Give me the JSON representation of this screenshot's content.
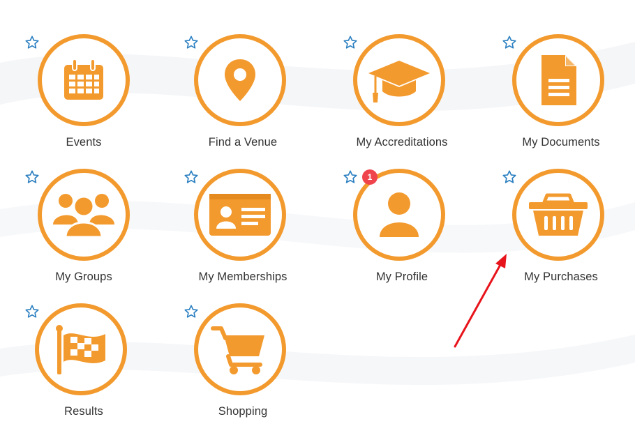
{
  "tiles": [
    {
      "label": "Events",
      "icon": "calendar-icon"
    },
    {
      "label": "Find a Venue",
      "icon": "location-pin-icon"
    },
    {
      "label": "My Accreditations",
      "icon": "graduation-cap-icon"
    },
    {
      "label": "My Documents",
      "icon": "document-icon"
    },
    {
      "label": "My Groups",
      "icon": "group-icon"
    },
    {
      "label": "My Memberships",
      "icon": "id-card-icon"
    },
    {
      "label": "My Profile",
      "icon": "user-icon",
      "badge": "1"
    },
    {
      "label": "My Purchases",
      "icon": "basket-icon"
    },
    {
      "label": "Results",
      "icon": "checkered-flag-icon"
    },
    {
      "label": "Shopping",
      "icon": "shopping-cart-icon"
    }
  ],
  "colors": {
    "accent": "#f39a2e",
    "star": "#2a7fc1",
    "badge": "#f0444c"
  }
}
